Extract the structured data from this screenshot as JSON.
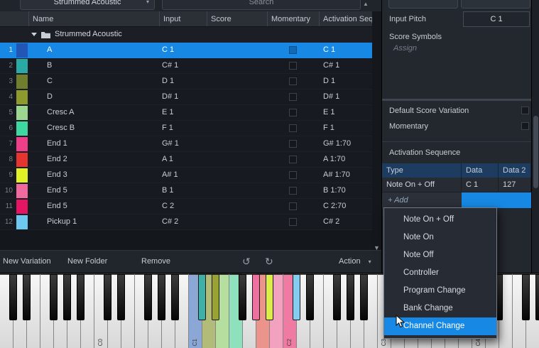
{
  "topbar": {
    "preset": "Strummed Acoustic",
    "search_placeholder": "Search"
  },
  "icons": {
    "caret_down": "▾",
    "scroll_up": "▲",
    "scroll_down": "▼",
    "undo": "↺",
    "redo": "↻"
  },
  "table": {
    "columns": [
      "Name",
      "Input",
      "Score",
      "Momentary",
      "Activation Sequence"
    ],
    "folder_name": "Strummed Acoustic",
    "rows": [
      {
        "num": 1,
        "color": "#2355b4",
        "name": "A",
        "input": "C 1",
        "score": "",
        "momentary": false,
        "activation": "C 1",
        "selected": true
      },
      {
        "num": 2,
        "color": "#2ba9a4",
        "name": "B",
        "input": "C# 1",
        "score": "",
        "momentary": false,
        "activation": "C# 1",
        "selected": false
      },
      {
        "num": 3,
        "color": "#6f7f2e",
        "name": "C",
        "input": "D 1",
        "score": "",
        "momentary": false,
        "activation": "D 1",
        "selected": false
      },
      {
        "num": 4,
        "color": "#8f9a2e",
        "name": "D",
        "input": "D# 1",
        "score": "",
        "momentary": false,
        "activation": "D# 1",
        "selected": false
      },
      {
        "num": 5,
        "color": "#9cd690",
        "name": "Cresc A",
        "input": "E 1",
        "score": "",
        "momentary": false,
        "activation": "E 1",
        "selected": false
      },
      {
        "num": 6,
        "color": "#3fd8a1",
        "name": "Cresc B",
        "input": "F 1",
        "score": "",
        "momentary": false,
        "activation": "F 1",
        "selected": false
      },
      {
        "num": 7,
        "color": "#ee3f88",
        "name": "End 1",
        "input": "G# 1",
        "score": "",
        "momentary": false,
        "activation": "G# 1:70",
        "selected": false
      },
      {
        "num": 8,
        "color": "#e43531",
        "name": "End 2",
        "input": "A 1",
        "score": "",
        "momentary": false,
        "activation": "A 1:70",
        "selected": false
      },
      {
        "num": 9,
        "color": "#e1f226",
        "name": "End 3",
        "input": "A# 1",
        "score": "",
        "momentary": false,
        "activation": "A# 1:70",
        "selected": false
      },
      {
        "num": 10,
        "color": "#ef6b9d",
        "name": "End 5",
        "input": "B 1",
        "score": "",
        "momentary": false,
        "activation": "B 1:70",
        "selected": false
      },
      {
        "num": 11,
        "color": "#e41562",
        "name": "End 5",
        "input": "C 2",
        "score": "",
        "momentary": false,
        "activation": "C 2:70",
        "selected": false
      },
      {
        "num": 12,
        "color": "#6fc8ef",
        "name": "Pickup 1",
        "input": "C# 2",
        "score": "",
        "momentary": false,
        "activation": "C# 2",
        "selected": false
      }
    ]
  },
  "toolbar": {
    "new_variation": "New Variation",
    "new_folder": "New Folder",
    "remove": "Remove",
    "action": "Action"
  },
  "inspector": {
    "input_pitch_label": "Input Pitch",
    "input_pitch_value": "C 1",
    "score_symbols_label": "Score Symbols",
    "score_symbols_placeholder": "Assign",
    "default_score_variation_label": "Default Score Variation",
    "momentary_label": "Momentary",
    "activation_sequence_label": "Activation Sequence",
    "sequence_table": {
      "headers": [
        "Type",
        "Data",
        "Data 2"
      ],
      "rows": [
        {
          "type": "Note On + Off",
          "data": "C 1",
          "data2": "127"
        }
      ],
      "add_label": "+ Add"
    }
  },
  "context_menu": {
    "items": [
      "Note On + Off",
      "Note On",
      "Note Off",
      "Controller",
      "Program Change",
      "Bank Change",
      "Channel Change"
    ],
    "highlighted": "Channel Change"
  },
  "keyboard": {
    "octave_labels": [
      "C0",
      "C1",
      "C2",
      "C3",
      "C4"
    ],
    "key_colors": {
      "C1": "#8ba7d6",
      "C#1": "#3fb0a8",
      "D1": "#b2bb78",
      "D#1": "#99a232",
      "E1": "#b5de9f",
      "F1": "#8fe0bd",
      "G#1": "#ef6f9f",
      "A1": "#ea948c",
      "A#1": "#dced49",
      "B1": "#f2a2bf",
      "C2": "#ef7ba3",
      "C#2": "#82cdf0"
    }
  },
  "colors": {
    "accent": "#1789e4",
    "selection": "#1789e4",
    "panel_bg": "#23272e",
    "table_bg": "#14171c",
    "seq_header_bg": "#1e3c5f"
  }
}
